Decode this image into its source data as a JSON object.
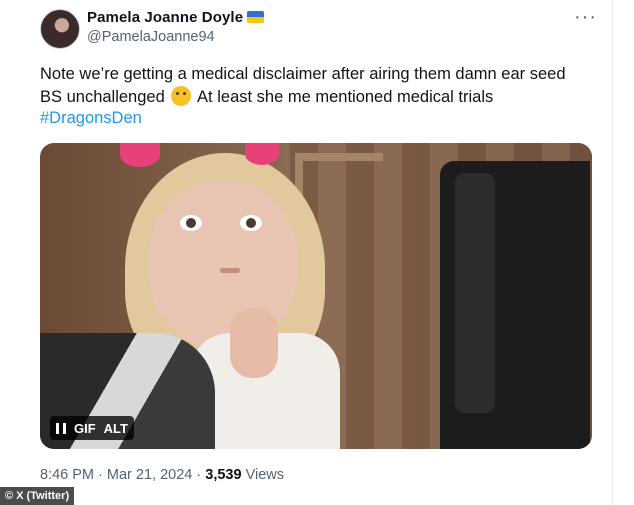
{
  "tweet": {
    "display_name": "Pamela Joanne Doyle",
    "handle": "@PamelaJoanne94",
    "more_label": "···",
    "text_line1": "Note we’re getting a medical disclaimer after airing them damn ear seed",
    "text_line2_a": "BS unchallenged",
    "text_line2_b": "At least she me mentioned medical trials",
    "emoji": "thinking-face",
    "hashtag": "#DragonsDen",
    "hashtag_color": "#1d9bf0"
  },
  "media": {
    "badge_gif": "GIF",
    "badge_alt": "ALT",
    "pause_icon": "pause-icon"
  },
  "meta": {
    "time": "8:46 PM",
    "sep1": "·",
    "date": "Mar 21, 2024",
    "sep2": "·",
    "views_count": "3,539",
    "views_label": "Views"
  },
  "credit": "© X (Twitter)",
  "colors": {
    "text": "#0f1419",
    "secondary": "#536471",
    "flag_blue": "#2f6fd0",
    "flag_yellow": "#f6c600"
  }
}
